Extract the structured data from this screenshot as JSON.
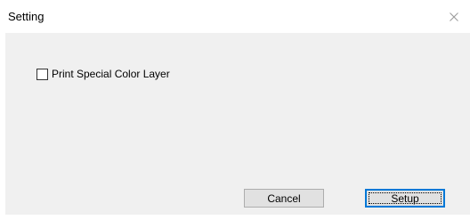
{
  "window": {
    "title": "Setting",
    "close_icon": "close-icon"
  },
  "options": {
    "print_special_color_layer": {
      "label": "Print Special Color Layer",
      "checked": false
    }
  },
  "buttons": {
    "cancel_label": "Cancel",
    "setup_label": "Setup"
  },
  "colors": {
    "dialog_background": "#f0f0f0",
    "titlebar_background": "#ffffff",
    "default_button_border": "#0078d7"
  }
}
